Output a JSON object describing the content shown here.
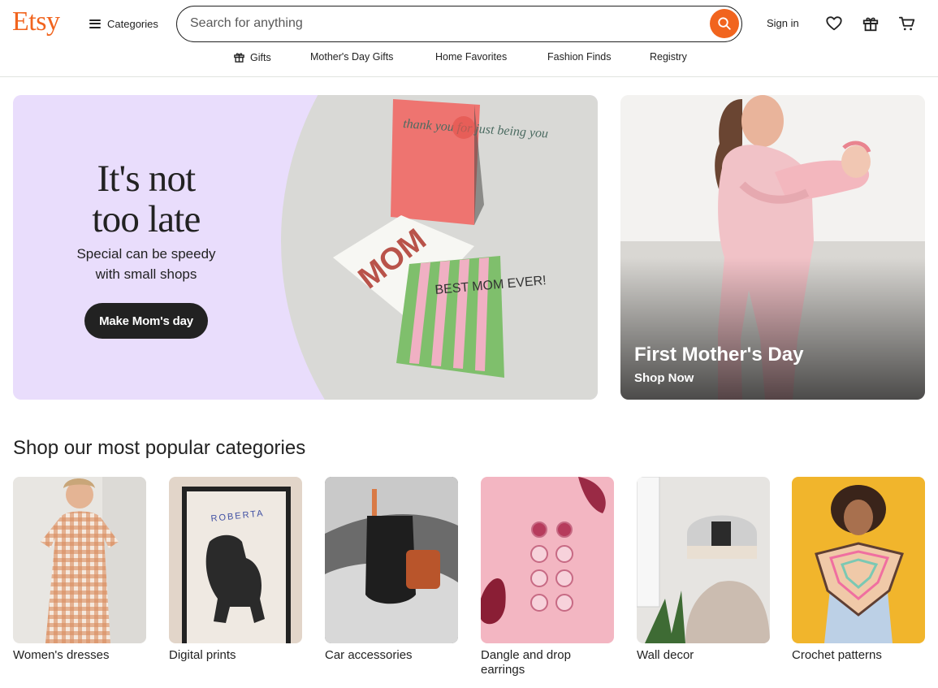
{
  "header": {
    "logo": "Etsy",
    "categories_label": "Categories",
    "search_placeholder": "Search for anything",
    "sign_in": "Sign in"
  },
  "subnav": [
    {
      "label": "Gifts",
      "icon": "gift-icon"
    },
    {
      "label": "Mother's Day Gifts"
    },
    {
      "label": "Home Favorites"
    },
    {
      "label": "Fashion Finds"
    },
    {
      "label": "Registry"
    }
  ],
  "hero": {
    "title_line1": "It's not",
    "title_line2": "too late",
    "subtitle_line1": "Special can be speedy",
    "subtitle_line2": "with small shops",
    "cta": "Make Mom's day",
    "card_text": [
      "thank you for just being you",
      "MOM",
      "BEST MOM EVER!"
    ]
  },
  "side_promo": {
    "title": "First Mother's Day",
    "cta": "Shop Now"
  },
  "categories_section": {
    "title": "Shop our most popular categories",
    "items": [
      {
        "label": "Women's dresses"
      },
      {
        "label": "Digital prints",
        "image_text": "ROBERTA"
      },
      {
        "label": "Car accessories"
      },
      {
        "label": "Dangle and drop earrings"
      },
      {
        "label": "Wall decor"
      },
      {
        "label": "Crochet patterns"
      }
    ]
  },
  "colors": {
    "brand": "#f1641e",
    "text": "#222222",
    "hero_bg": "#e9ddfc"
  }
}
